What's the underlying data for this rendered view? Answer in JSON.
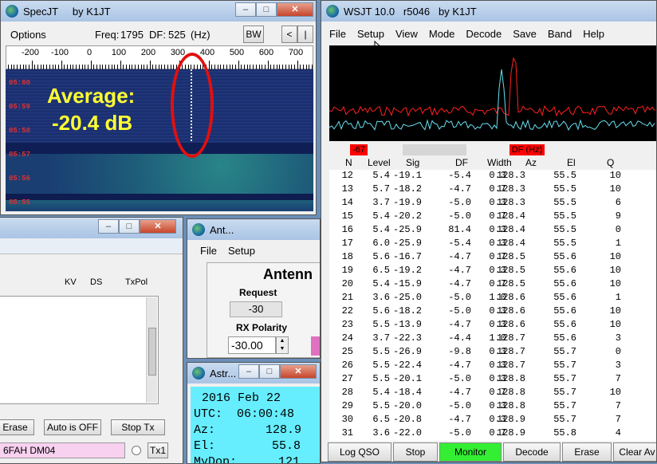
{
  "specjt": {
    "title": "SpecJT     by K1JT",
    "options_label": "Options",
    "freq_label": "Freq:",
    "freq_value": "1795",
    "df_label": "DF:",
    "df_value": "525",
    "df_unit": "(Hz)",
    "bw_label": "BW",
    "nav_left": "<",
    "nav_bar": "|",
    "axis_ticks": [
      "-200",
      "-100",
      "0",
      "100",
      "200",
      "300",
      "400",
      "500",
      "600",
      "700"
    ],
    "time_labels": [
      "05:60",
      "05:59",
      "05:58",
      "05:57",
      "05:56",
      "05:55"
    ],
    "overlay_line1": "Average:",
    "overlay_line2": "-20.4 dB"
  },
  "wsjt": {
    "title": "WSJT 10.0   r5046   by K1JT",
    "menu": [
      "File",
      "Setup",
      "View",
      "Mode",
      "Decode",
      "Save",
      "Band",
      "Help"
    ],
    "level_badge": "-67",
    "df_badge": "DF (Hz)",
    "columns": [
      "N",
      "Level",
      "Sig",
      "DF",
      "Width",
      "Az",
      "El",
      "Q"
    ],
    "rows": [
      [
        "12",
        "5.4",
        "-19.1",
        "-5.4",
        "0.3",
        "128.3",
        "55.5",
        "10"
      ],
      [
        "13",
        "5.7",
        "-18.2",
        "-4.7",
        "0.7",
        "128.3",
        "55.5",
        "10"
      ],
      [
        "14",
        "3.7",
        "-19.9",
        "-5.0",
        "0.3",
        "128.3",
        "55.5",
        "6"
      ],
      [
        "15",
        "5.4",
        "-20.2",
        "-5.0",
        "0.7",
        "128.4",
        "55.5",
        "9"
      ],
      [
        "16",
        "5.4",
        "-25.9",
        "81.4",
        "0.3",
        "128.4",
        "55.5",
        "0"
      ],
      [
        "17",
        "6.0",
        "-25.9",
        "-5.4",
        "0.3",
        "128.4",
        "55.5",
        "1"
      ],
      [
        "18",
        "5.6",
        "-16.7",
        "-4.7",
        "0.7",
        "128.5",
        "55.6",
        "10"
      ],
      [
        "19",
        "6.5",
        "-19.2",
        "-4.7",
        "0.3",
        "128.5",
        "55.6",
        "10"
      ],
      [
        "20",
        "5.4",
        "-15.9",
        "-4.7",
        "0.7",
        "128.5",
        "55.6",
        "10"
      ],
      [
        "21",
        "3.6",
        "-25.0",
        "-5.0",
        "1.0",
        "128.6",
        "55.6",
        "1"
      ],
      [
        "22",
        "5.6",
        "-18.2",
        "-5.0",
        "0.3",
        "128.6",
        "55.6",
        "10"
      ],
      [
        "23",
        "5.5",
        "-13.9",
        "-4.7",
        "0.3",
        "128.6",
        "55.6",
        "10"
      ],
      [
        "24",
        "3.7",
        "-22.3",
        "-4.4",
        "1.0",
        "128.7",
        "55.6",
        "3"
      ],
      [
        "25",
        "5.5",
        "-26.9",
        "-9.8",
        "0.3",
        "128.7",
        "55.7",
        "0"
      ],
      [
        "26",
        "5.5",
        "-22.4",
        "-4.7",
        "0.3",
        "128.7",
        "55.7",
        "3"
      ],
      [
        "27",
        "5.5",
        "-20.1",
        "-5.0",
        "0.3",
        "128.8",
        "55.7",
        "7"
      ],
      [
        "28",
        "5.4",
        "-18.4",
        "-4.7",
        "0.7",
        "128.8",
        "55.7",
        "10"
      ],
      [
        "29",
        "5.5",
        "-20.0",
        "-5.0",
        "0.3",
        "128.8",
        "55.7",
        "7"
      ],
      [
        "30",
        "6.5",
        "-20.8",
        "-4.7",
        "0.3",
        "128.9",
        "55.7",
        "7"
      ],
      [
        "31",
        "3.6",
        "-22.0",
        "-5.0",
        "0.7",
        "128.9",
        "55.8",
        "4"
      ]
    ],
    "buttons": [
      "Log QSO",
      "Stop",
      "Monitor",
      "Decode",
      "Erase",
      "Clear Av"
    ]
  },
  "leftwin": {
    "cols": [
      "KV",
      "DS",
      "TxPol"
    ],
    "erase_label": "Erase",
    "auto_label": "Auto is OFF",
    "stoptx_label": "Stop Tx",
    "callsign_value": "6FAH DM04",
    "tx1_label": "Tx1"
  },
  "antenna": {
    "title": "Ant...",
    "menu": [
      "File",
      "Setup"
    ],
    "heading": "Antenn",
    "request_label": "Request",
    "request_value": "-30",
    "rxpol_label": "RX Polarity",
    "rxpol_value": "-30.00"
  },
  "astro": {
    "title": "Astr...",
    "date": "2016 Feb 22",
    "utc_label": "UTC:",
    "utc_value": "06:00:48",
    "az_label": "Az:",
    "az_value": "128.9",
    "el_label": "El:",
    "el_value": "55.8",
    "mydop_label": "MyDop:",
    "mydop_value": "121"
  },
  "colors": {
    "waterfall_bg": "#1c2f6a",
    "overlay_text": "#ffff33",
    "ellipse": "#e01010",
    "red_trace": "#ff2020",
    "cyan_trace": "#66e0f0",
    "monitor_green": "#33ee33",
    "astro_bg": "#66eeff"
  }
}
